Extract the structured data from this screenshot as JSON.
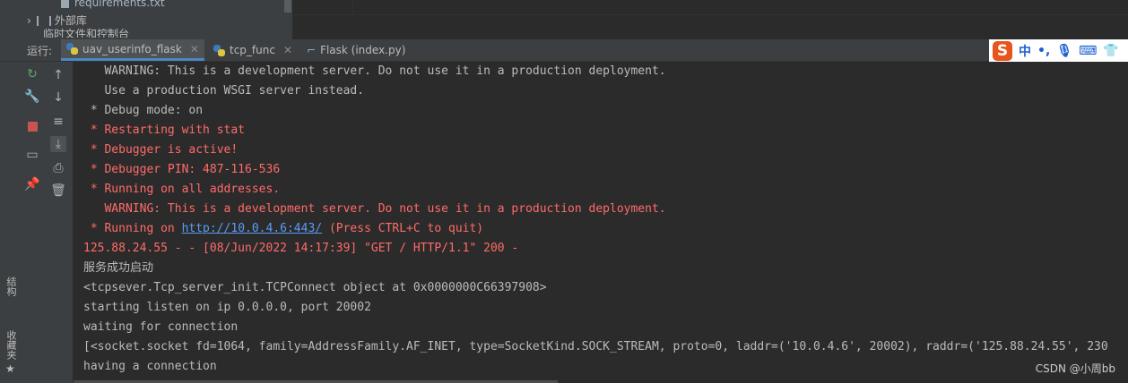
{
  "project_tree": {
    "requirements_file": "requirements.txt",
    "external_libs": "外部库",
    "scratch_partial": "临时文件和控制台"
  },
  "run_panel": {
    "label": "运行:",
    "tabs": [
      {
        "label": "uav_userinfo_flask",
        "active": true,
        "icon": "python-icon"
      },
      {
        "label": "tcp_func",
        "active": false,
        "icon": "python-icon"
      },
      {
        "label": "Flask (index.py)",
        "active": false,
        "icon": "flask-icon"
      }
    ]
  },
  "ime_toolbar": {
    "logo": "S",
    "lang": "中",
    "punct": "•,",
    "items": [
      "mic-icon",
      "keyboard-icon",
      "shirt-icon"
    ]
  },
  "side_labels": {
    "structure": "结构",
    "favorites": "收藏夹"
  },
  "console_lines": [
    {
      "text": "   WARNING: This is a development server. Do not use it in a production deployment.",
      "style": "normal"
    },
    {
      "text": "   Use a production WSGI server instead.",
      "style": "normal"
    },
    {
      "text": " * Debug mode: on",
      "style": "normal"
    },
    {
      "text": " * Restarting with stat",
      "style": "red"
    },
    {
      "text": " * Debugger is active!",
      "style": "red"
    },
    {
      "text": " * Debugger PIN: 487-116-536",
      "style": "red"
    },
    {
      "text": " * Running on all addresses.",
      "style": "red"
    },
    {
      "text": "   WARNING: This is a development server. Do not use it in a production deployment.",
      "style": "red"
    },
    {
      "text": "125.88.24.55 - - [08/Jun/2022 14:17:39] \"GET / HTTP/1.1\" 200 -",
      "style": "red"
    },
    {
      "text": "服务成功启动",
      "style": "normal"
    },
    {
      "text": "<tcpsever.Tcp_server_init.TCPConnect object at 0x0000000C66397908>",
      "style": "normal"
    },
    {
      "text": "starting listen on ip 0.0.0.0, port 20002",
      "style": "normal"
    },
    {
      "text": "waiting for connection",
      "style": "normal"
    },
    {
      "text": "[<socket.socket fd=1064, family=AddressFamily.AF_INET, type=SocketKind.SOCK_STREAM, proto=0, laddr=('10.0.4.6', 20002), raddr=('125.88.24.55', 230",
      "style": "normal"
    },
    {
      "text": "having a connection",
      "style": "normal"
    }
  ],
  "running_line": {
    "prefix": " * Running on ",
    "url": "http://10.0.4.6:443/",
    "suffix": " (Press CTRL+C to quit)"
  },
  "watermark": "CSDN @小周bb",
  "colors": {
    "error_red": "#ff6b68",
    "link_blue": "#589df6",
    "text": "#bbbbbb",
    "background": "#2b2b2b"
  }
}
